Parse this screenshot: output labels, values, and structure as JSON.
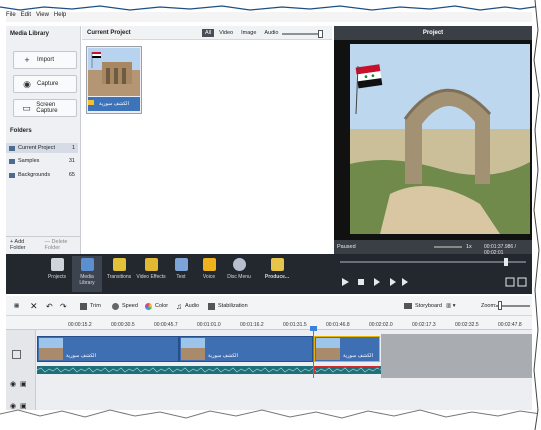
{
  "menu": [
    "File",
    "Edit",
    "View",
    "Help"
  ],
  "library": {
    "title": "Media Library",
    "buttons": [
      "Import",
      "Capture",
      "Screen Capture"
    ],
    "folders_title": "Folders",
    "folders": [
      {
        "name": "Current Project",
        "count": "1"
      },
      {
        "name": "Samples",
        "count": "31"
      },
      {
        "name": "Backgrounds",
        "count": "65"
      }
    ],
    "add_folder": "+ Add Folder",
    "delete_folder": "— Delete Folder"
  },
  "project_panel": {
    "title": "Current Project",
    "tabs": [
      "All",
      "Video",
      "Image",
      "Audio"
    ],
    "item_caption": "الكشف سورية"
  },
  "preview": {
    "title": "Project",
    "status": "Paused",
    "speed": "1x",
    "time": "00:01:37.986 / 00:02:01"
  },
  "toolbar": [
    "Projects",
    "Media Library",
    "Transitions",
    "Video Effects",
    "Text",
    "Voice",
    "Disc Menu",
    "Produce..."
  ],
  "timeline_tools": {
    "trim": "Trim",
    "speed": "Speed",
    "color": "Color",
    "audio": "Audio",
    "stabilization": "Stabilization",
    "storyboard": "Storyboard",
    "zoom": "Zoom:"
  },
  "ruler": [
    "00:00:15.2",
    "00:00:30.5",
    "00:00:45.7",
    "00:01:01.0",
    "00:01:16.2",
    "00:01:31.5",
    "00:01:46.8",
    "00:02:02.0",
    "00:02:17.3",
    "00:02:32.5",
    "00:02:47.8"
  ],
  "clips": [
    "الكشف سورية",
    "الكشف سورية",
    "الكشف سورية"
  ],
  "colors": {
    "accent": "#3e6fb3",
    "dark": "#23272e",
    "selection": "#d6dce6"
  }
}
